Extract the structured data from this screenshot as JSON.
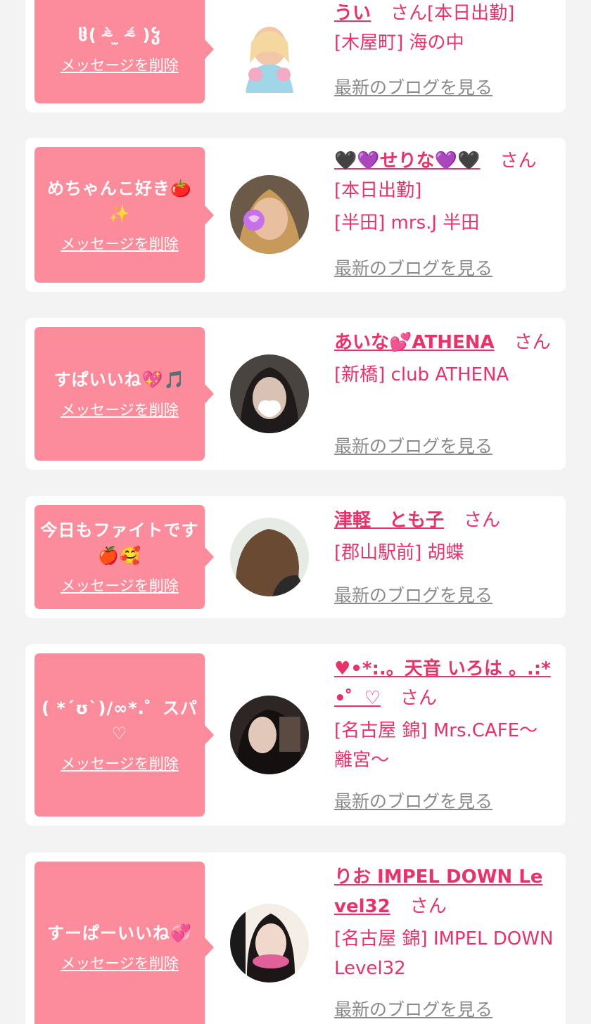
{
  "cards": [
    {
      "message": "ჱ̒( ⁼̴̀ ̫ ⁼̴́ )ჴ",
      "delete_label": "メッセージを削除",
      "cast_name": "うい",
      "suffix": "さん[本日出勤]",
      "shop": "[木屋町] 海の中",
      "blog_label": "最新のブログを見る"
    },
    {
      "message": "めちゃんこ好き🍅✨",
      "delete_label": "メッセージを削除",
      "cast_name": "🖤💜せりな💜🖤",
      "suffix": "さん[本日出勤]",
      "shop": "[半田] mrs.J 半田",
      "blog_label": "最新のブログを見る"
    },
    {
      "message": "すぱいいね💖🎵",
      "delete_label": "メッセージを削除",
      "cast_name": "あいな💕ATHENA",
      "suffix": "さん",
      "shop": "[新橋] club ATHENA",
      "blog_label": "最新のブログを見る"
    },
    {
      "message": "今日もファイトです🍎🥰",
      "delete_label": "メッセージを削除",
      "cast_name": "津軽　とも子",
      "suffix": "さん",
      "shop": "[郡山駅前] 胡蝶",
      "blog_label": "最新のブログを見る"
    },
    {
      "message": "( *´ʊ`)/∞*.゜スパ♡",
      "delete_label": "メッセージを削除",
      "cast_name": "♥•*:.。天音 いろは 。.:*•゜♡",
      "suffix": "さん",
      "shop": "[名古屋 錦] Mrs.CAFE～離宮～",
      "blog_label": "最新のブログを見る"
    },
    {
      "message": "すーぱーいいね💞",
      "delete_label": "メッセージを削除",
      "cast_name": "りお IMPEL DOWN Level32",
      "suffix": "さん",
      "shop": "[名古屋 錦] IMPEL DOWN Level32",
      "blog_label": "最新のブログを見る"
    }
  ],
  "colors": {
    "bubble": "#fc8c9b",
    "accent": "#e8336a",
    "muted": "#8a8a8a"
  }
}
